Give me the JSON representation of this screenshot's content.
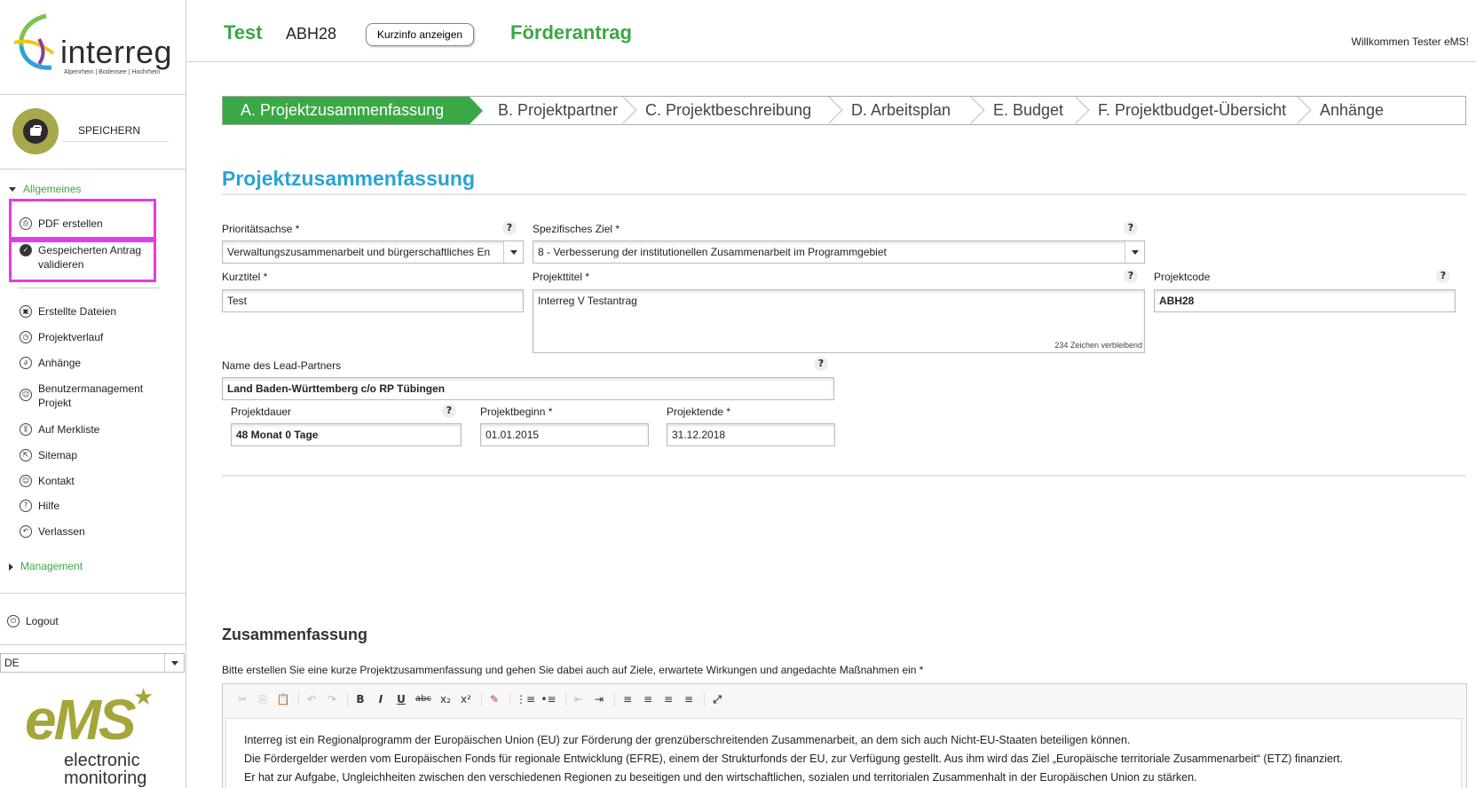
{
  "brand": {
    "logo_word": "interreg",
    "logo_tagline": "Alpenrhein | Bodensee | Hochrhein",
    "ems_big": "eMS",
    "ems_line1": "electronic",
    "ems_line2": "monitoring"
  },
  "sidebar": {
    "save_label": "SPEICHERN",
    "group_allgemeines": "Allgemeines",
    "group_management": "Management",
    "items": [
      {
        "label": "PDF erstellen",
        "icon": "printer-icon"
      },
      {
        "label": "Gespeicherten Antrag validieren",
        "icon": "check-icon"
      },
      {
        "label": "Erstellte Dateien",
        "icon": "disk-icon"
      },
      {
        "label": "Projektverlauf",
        "icon": "history-icon"
      },
      {
        "label": "Anhänge",
        "icon": "paperclip-icon"
      },
      {
        "label": "Benutzermanagement Projekt",
        "icon": "user-icon"
      },
      {
        "label": "Auf Merkliste",
        "icon": "bookmark-icon"
      },
      {
        "label": "Sitemap",
        "icon": "sitemap-icon"
      },
      {
        "label": "Kontakt",
        "icon": "contact-icon"
      },
      {
        "label": "Hilfe",
        "icon": "help-icon"
      },
      {
        "label": "Verlassen",
        "icon": "back-icon"
      }
    ],
    "logout_label": "Logout",
    "language": "DE",
    "highlight_color": "#e83ae8"
  },
  "header": {
    "project_acronym": "Test",
    "project_code": "ABH28",
    "kurzinfo_button": "Kurzinfo anzeigen",
    "form_title": "Förderantrag",
    "welcome": "Willkommen Tester eMS!",
    "accent_color": "#3aa845"
  },
  "steps": [
    {
      "label": "A. Projektzusammenfassung",
      "active": true
    },
    {
      "label": "B. Projektpartner"
    },
    {
      "label": "C. Projektbeschreibung"
    },
    {
      "label": "D. Arbeitsplan"
    },
    {
      "label": "E. Budget"
    },
    {
      "label": "F. Projektbudget-Übersicht"
    },
    {
      "label": "Anhänge"
    }
  ],
  "form": {
    "section_title": "Projektzusammenfassung",
    "help_glyph": "?",
    "prioritaetsachse_label": "Prioritätsachse *",
    "prioritaetsachse_value": "Verwaltungszusammenarbeit und bürgerschaftliches En",
    "spezifisches_ziel_label": "Spezifisches Ziel *",
    "spezifisches_ziel_value": "8 - Verbesserung der institutionellen Zusammenarbeit im Programmgebiet",
    "kurztitel_label": "Kurztitel *",
    "kurztitel_value": "Test",
    "projekttitel_label": "Projekttitel *",
    "projekttitel_value": "Interreg V Testantrag",
    "projekttitel_remaining": "234 Zeichen verbleibend",
    "projektcode_label": "Projektcode",
    "projektcode_value": "ABH28",
    "leadpartner_label": "Name des Lead-Partners",
    "leadpartner_value": "Land Baden-Württemberg c/o RP Tübingen",
    "projektdauer_label": "Projektdauer",
    "projektdauer_value": "48 Monat 0 Tage",
    "projektbeginn_label": "Projektbeginn *",
    "projektbeginn_value": "01.01.2015",
    "projektende_label": "Projektende *",
    "projektende_value": "31.12.2018"
  },
  "summary": {
    "title": "Zusammenfassung",
    "instruction": "Bitte erstellen Sie eine kurze Projektzusammenfassung und gehen Sie dabei auch auf Ziele, erwartete Wirkungen und angedachte Maßnahmen ein *",
    "paragraphs": [
      "Interreg ist ein Regionalprogramm der Europäischen Union (EU) zur Förderung der grenzüberschreitenden Zusammenarbeit, an dem sich auch Nicht-EU-Staaten beteiligen können.",
      "Die Fördergelder werden vom Europäischen Fonds für regionale Entwicklung (EFRE), einem der Strukturfonds der EU, zur Verfügung gestellt. Aus ihm wird das Ziel „Europäische territoriale Zusammenarbeit“ (ETZ) finanziert.",
      "Er hat zur Aufgabe, Ungleichheiten zwischen den verschiedenen Regionen zu beseitigen und den wirtschaftlichen, sozialen und territorialen Zusammenhalt in der Europäischen Union zu stärken."
    ],
    "toolbar": {
      "cut": "✂",
      "copy": "⎘",
      "paste_text": "📋",
      "undo": "↶",
      "redo": "↷",
      "bold": "B",
      "italic": "I",
      "underline": "U",
      "strike": "abc",
      "subscript": "x₂",
      "superscript": "x²",
      "remove_format": "✎",
      "numbered_list": "⋮≡",
      "bullet_list": "•≡",
      "outdent": "⇤",
      "indent": "⇥",
      "align_left": "≡",
      "align_center": "≡",
      "align_right": "≡",
      "justify": "≡",
      "maximize": "⤢"
    }
  }
}
